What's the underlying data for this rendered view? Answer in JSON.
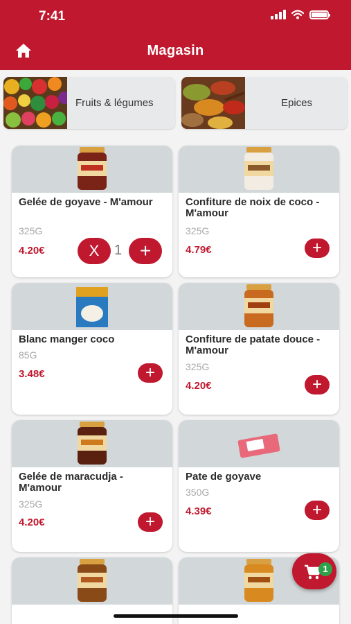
{
  "status_bar": {
    "time": "7:41"
  },
  "header": {
    "title": "Magasin"
  },
  "categories": [
    {
      "label": "Fruits & légumes"
    },
    {
      "label": "Epices"
    }
  ],
  "products": [
    {
      "name": "Gelée de goyave - M'amour",
      "weight": "325G",
      "price": "4.20€",
      "in_cart": true,
      "quantity": "1"
    },
    {
      "name": "Confiture de noix de coco - M'amour",
      "weight": "325G",
      "price": "4.79€",
      "in_cart": false
    },
    {
      "name": "Blanc manger coco",
      "weight": "85G",
      "price": "3.48€",
      "in_cart": false
    },
    {
      "name": "Confiture de patate douce - M'amour",
      "weight": "325G",
      "price": "4.20€",
      "in_cart": false
    },
    {
      "name": "Gelée de maracudja - M'amour",
      "weight": "325G",
      "price": "4.20€",
      "in_cart": false
    },
    {
      "name": "Pate de goyave",
      "weight": "350G",
      "price": "4.39€",
      "in_cart": false
    }
  ],
  "buttons": {
    "add_label": "+",
    "remove_label": "X"
  },
  "cart": {
    "count": "1"
  },
  "colors": {
    "primary": "#c0192f",
    "badge": "#2ea24a"
  },
  "icons": {
    "home": "home-icon",
    "cart": "cart-icon"
  }
}
